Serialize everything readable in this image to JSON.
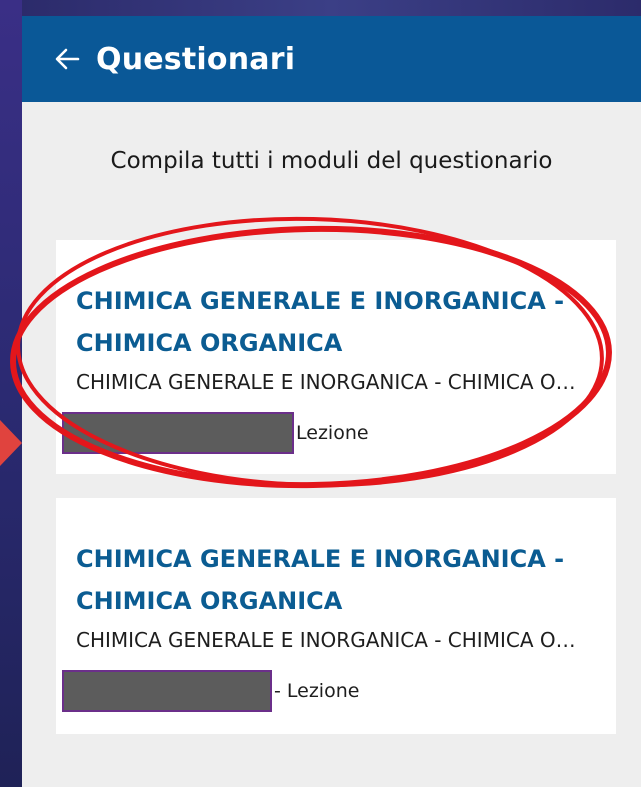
{
  "header": {
    "title": "Questionari",
    "back_icon": "arrow-left-icon"
  },
  "subtitle": "Compila tutti i moduli del questionario",
  "cards": [
    {
      "title_line1": "CHIMICA GENERALE E INORGANICA -",
      "title_line2": "CHIMICA ORGANICA",
      "description": "CHIMICA GENERALE E INORGANICA - CHIMICA ORGANICA",
      "meta": "Lezione"
    },
    {
      "title_line1": "CHIMICA GENERALE E INORGANICA -",
      "title_line2": "CHIMICA ORGANICA",
      "description": "CHIMICA GENERALE E INORGANICA - CHIMICA ORGANICA",
      "meta": "- Lezione"
    }
  ],
  "colors": {
    "appbar": "#0a5897",
    "card_title": "#0b5c92",
    "annotation": "#e3161b"
  }
}
